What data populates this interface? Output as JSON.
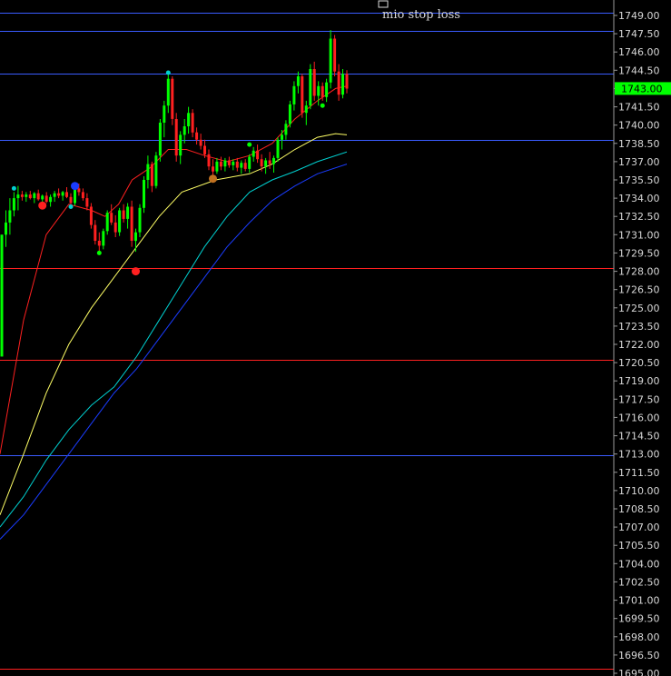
{
  "chart_data": {
    "type": "candlestick",
    "ylim": [
      1695.0,
      1750.5
    ],
    "y_ticks": [
      "1749.00",
      "1747.50",
      "1746.00",
      "1744.50",
      "1743.00",
      "1741.50",
      "1740.00",
      "1738.50",
      "1737.00",
      "1735.50",
      "1734.00",
      "1732.50",
      "1731.00",
      "1729.50",
      "1728.00",
      "1726.50",
      "1725.00",
      "1723.50",
      "1722.00",
      "1720.50",
      "1719.00",
      "1717.50",
      "1716.00",
      "1714.50",
      "1713.00",
      "1711.50",
      "1710.00",
      "1708.50",
      "1707.00",
      "1705.50",
      "1704.00",
      "1702.50",
      "1701.00",
      "1699.50",
      "1698.00",
      "1696.50",
      "1695.00"
    ],
    "last_price": "1743.00",
    "annotation": "mio stop loss",
    "colors": {
      "background": "#000000",
      "up": "#00ff00",
      "down": "#ff2020",
      "ema_fast": "#ff2020",
      "ema_mid": "#ffff66",
      "ema_slow": "#00d0d0",
      "ema_slowest": "#1a3cff",
      "level_blue": "#3a5cff",
      "level_red": "#ff2020",
      "badge": "#00ff00"
    },
    "levels": [
      {
        "value": 1749.2,
        "color": "blue"
      },
      {
        "value": 1747.7,
        "color": "blue"
      },
      {
        "value": 1744.2,
        "color": "blue"
      },
      {
        "value": 1738.8,
        "color": "blue"
      },
      {
        "value": 1728.3,
        "color": "red"
      },
      {
        "value": 1720.7,
        "color": "red"
      },
      {
        "value": 1712.9,
        "color": "blue"
      },
      {
        "value": 1695.4,
        "color": "red"
      }
    ],
    "candles": [
      [
        1721,
        1731,
        1721,
        1731
      ],
      [
        1731,
        1733,
        1730,
        1732
      ],
      [
        1732,
        1734,
        1731,
        1733
      ],
      [
        1733,
        1734.5,
        1732.5,
        1734
      ],
      [
        1734,
        1735,
        1733,
        1734.3
      ],
      [
        1734.3,
        1734.6,
        1733.8,
        1734.1
      ],
      [
        1734.1,
        1734.5,
        1733.7,
        1734.3
      ],
      [
        1734.3,
        1734.6,
        1733.9,
        1734.0
      ],
      [
        1734.0,
        1734.5,
        1733.6,
        1734.4
      ],
      [
        1734.4,
        1734.7,
        1733.8,
        1733.9
      ],
      [
        1733.9,
        1734.3,
        1733.4,
        1734.2
      ],
      [
        1734.2,
        1734.5,
        1733.6,
        1733.7
      ],
      [
        1733.7,
        1734.3,
        1733.3,
        1734.1
      ],
      [
        1734.1,
        1734.6,
        1733.7,
        1734.4
      ],
      [
        1734.4,
        1734.8,
        1734.0,
        1734.2
      ],
      [
        1734.2,
        1734.6,
        1733.8,
        1734.5
      ],
      [
        1734.5,
        1734.9,
        1734.0,
        1734.1
      ],
      [
        1734.1,
        1734.4,
        1733.3,
        1733.6
      ],
      [
        1733.6,
        1735.0,
        1733.4,
        1734.8
      ],
      [
        1734.8,
        1735.2,
        1734.2,
        1734.5
      ],
      [
        1734.5,
        1734.8,
        1733.8,
        1734.0
      ],
      [
        1734.0,
        1734.4,
        1733.0,
        1733.3
      ],
      [
        1733.3,
        1733.6,
        1731.5,
        1731.8
      ],
      [
        1731.8,
        1732.2,
        1730.2,
        1730.5
      ],
      [
        1730.5,
        1731.2,
        1729.6,
        1730.1
      ],
      [
        1730.1,
        1731.5,
        1729.8,
        1731.3
      ],
      [
        1731.3,
        1733.0,
        1731.0,
        1732.8
      ],
      [
        1732.8,
        1733.5,
        1731.8,
        1732.0
      ],
      [
        1732.0,
        1732.6,
        1730.8,
        1731.2
      ],
      [
        1731.2,
        1733.2,
        1730.9,
        1733.0
      ],
      [
        1733.0,
        1733.5,
        1732.0,
        1732.3
      ],
      [
        1732.3,
        1733.6,
        1731.5,
        1733.3
      ],
      [
        1733.3,
        1733.8,
        1730.0,
        1730.5
      ],
      [
        1730.5,
        1731.5,
        1729.6,
        1731.2
      ],
      [
        1731.2,
        1733.5,
        1730.8,
        1733.2
      ],
      [
        1733.2,
        1735.8,
        1732.8,
        1735.5
      ],
      [
        1735.5,
        1737.5,
        1734.8,
        1736.8
      ],
      [
        1736.8,
        1737.0,
        1734.5,
        1735.0
      ],
      [
        1735.0,
        1737.8,
        1734.8,
        1737.5
      ],
      [
        1737.5,
        1740.5,
        1737.0,
        1740.2
      ],
      [
        1740.2,
        1742.0,
        1739.0,
        1741.6
      ],
      [
        1741.6,
        1744.2,
        1741.0,
        1743.8
      ],
      [
        1743.8,
        1744.0,
        1740.0,
        1740.5
      ],
      [
        1740.5,
        1741.0,
        1737.0,
        1737.5
      ],
      [
        1737.5,
        1739.5,
        1736.8,
        1739.2
      ],
      [
        1739.2,
        1740.5,
        1738.5,
        1739.9
      ],
      [
        1739.9,
        1741.5,
        1739.3,
        1741.0
      ],
      [
        1741.0,
        1741.3,
        1739.0,
        1739.4
      ],
      [
        1739.4,
        1739.8,
        1738.4,
        1738.8
      ],
      [
        1738.8,
        1739.3,
        1738.0,
        1738.3
      ],
      [
        1738.3,
        1738.8,
        1737.3,
        1737.6
      ],
      [
        1737.6,
        1738.0,
        1736.3,
        1736.6
      ],
      [
        1736.6,
        1737.2,
        1735.8,
        1736.2
      ],
      [
        1736.2,
        1737.3,
        1736.0,
        1737.0
      ],
      [
        1737.0,
        1737.4,
        1736.3,
        1736.6
      ],
      [
        1736.6,
        1737.3,
        1736.2,
        1737.1
      ],
      [
        1737.1,
        1737.4,
        1736.5,
        1736.7
      ],
      [
        1736.7,
        1737.2,
        1736.3,
        1737.0
      ],
      [
        1737.0,
        1737.3,
        1736.2,
        1736.5
      ],
      [
        1736.5,
        1737.1,
        1736.0,
        1736.9
      ],
      [
        1736.9,
        1737.2,
        1736.2,
        1736.4
      ],
      [
        1736.4,
        1737.6,
        1736.1,
        1737.4
      ],
      [
        1737.4,
        1738.2,
        1737.0,
        1737.9
      ],
      [
        1737.9,
        1738.4,
        1736.9,
        1737.2
      ],
      [
        1737.2,
        1737.6,
        1736.2,
        1736.6
      ],
      [
        1736.6,
        1737.3,
        1736.0,
        1737.1
      ],
      [
        1737.1,
        1737.8,
        1736.4,
        1736.8
      ],
      [
        1736.8,
        1737.5,
        1736.1,
        1737.3
      ],
      [
        1737.3,
        1739.0,
        1737.0,
        1738.8
      ],
      [
        1738.8,
        1739.6,
        1738.0,
        1739.2
      ],
      [
        1739.2,
        1740.4,
        1738.8,
        1740.1
      ],
      [
        1740.1,
        1742.0,
        1739.8,
        1741.7
      ],
      [
        1741.7,
        1743.6,
        1741.2,
        1743.2
      ],
      [
        1743.2,
        1744.4,
        1742.6,
        1744.0
      ],
      [
        1744.0,
        1744.2,
        1740.6,
        1741.0
      ],
      [
        1741.0,
        1742.0,
        1740.0,
        1741.6
      ],
      [
        1741.6,
        1745.0,
        1741.3,
        1744.6
      ],
      [
        1744.6,
        1745.2,
        1742.0,
        1742.4
      ],
      [
        1742.4,
        1743.6,
        1741.6,
        1743.2
      ],
      [
        1743.2,
        1743.5,
        1742.0,
        1742.3
      ],
      [
        1742.3,
        1743.8,
        1741.9,
        1743.5
      ],
      [
        1743.5,
        1747.8,
        1743.0,
        1747.1
      ],
      [
        1747.1,
        1747.4,
        1744.0,
        1744.4
      ],
      [
        1744.4,
        1745.0,
        1742.0,
        1742.5
      ],
      [
        1742.5,
        1744.6,
        1742.2,
        1744.2
      ],
      [
        1744.2,
        1744.5,
        1742.6,
        1743.0
      ]
    ],
    "ema_fast": [
      [
        0,
        1713
      ],
      [
        10,
        1724
      ],
      [
        20,
        1731
      ],
      [
        30,
        1733.5
      ],
      [
        40,
        1733
      ],
      [
        46,
        1732.5
      ],
      [
        52,
        1733.5
      ],
      [
        58,
        1735.5
      ],
      [
        66,
        1736.5
      ],
      [
        74,
        1738
      ],
      [
        82,
        1738
      ],
      [
        90,
        1737.5
      ],
      [
        100,
        1737
      ],
      [
        110,
        1737.5
      ],
      [
        120,
        1738.5
      ],
      [
        130,
        1740.5
      ],
      [
        140,
        1742
      ],
      [
        148,
        1743
      ],
      [
        153,
        1743.2
      ]
    ],
    "ema_mid": [
      [
        0,
        1708
      ],
      [
        10,
        1713
      ],
      [
        20,
        1718
      ],
      [
        30,
        1722
      ],
      [
        40,
        1725
      ],
      [
        50,
        1727.5
      ],
      [
        60,
        1730
      ],
      [
        70,
        1732.5
      ],
      [
        80,
        1734.5
      ],
      [
        95,
        1735.5
      ],
      [
        110,
        1736
      ],
      [
        120,
        1736.8
      ],
      [
        130,
        1738
      ],
      [
        140,
        1739
      ],
      [
        148,
        1739.3
      ],
      [
        153,
        1739.2
      ]
    ],
    "ema_slow": [
      [
        0,
        1707
      ],
      [
        10,
        1709.5
      ],
      [
        20,
        1712.5
      ],
      [
        30,
        1715
      ],
      [
        40,
        1717
      ],
      [
        50,
        1718.5
      ],
      [
        60,
        1721
      ],
      [
        70,
        1724
      ],
      [
        80,
        1727
      ],
      [
        90,
        1730
      ],
      [
        100,
        1732.5
      ],
      [
        110,
        1734.5
      ],
      [
        120,
        1735.5
      ],
      [
        130,
        1736.2
      ],
      [
        140,
        1737
      ],
      [
        153,
        1737.8
      ]
    ],
    "ema_slowest": [
      [
        0,
        1706
      ],
      [
        10,
        1708
      ],
      [
        20,
        1710.5
      ],
      [
        30,
        1713
      ],
      [
        40,
        1715.5
      ],
      [
        50,
        1718
      ],
      [
        60,
        1720
      ],
      [
        70,
        1722.5
      ],
      [
        80,
        1725
      ],
      [
        90,
        1727.5
      ],
      [
        100,
        1730
      ],
      [
        110,
        1732
      ],
      [
        120,
        1733.8
      ],
      [
        130,
        1735
      ],
      [
        140,
        1736
      ],
      [
        153,
        1736.8
      ]
    ],
    "markers": [
      {
        "i": 3,
        "v": 1734.8,
        "color": "#00d0d0",
        "type": "small"
      },
      {
        "i": 10,
        "v": 1733.4,
        "color": "#ff2020",
        "type": "big"
      },
      {
        "i": 17,
        "v": 1733.3,
        "color": "#00d0d0",
        "type": "small"
      },
      {
        "i": 18,
        "v": 1735.0,
        "color": "#1a3cff",
        "type": "big"
      },
      {
        "i": 24,
        "v": 1729.5,
        "color": "#00ff00",
        "type": "small"
      },
      {
        "i": 33,
        "v": 1728.0,
        "color": "#ff2020",
        "type": "big"
      },
      {
        "i": 41,
        "v": 1744.3,
        "color": "#00d0d0",
        "type": "small"
      },
      {
        "i": 52,
        "v": 1735.6,
        "color": "#c07020",
        "type": "big"
      },
      {
        "i": 61,
        "v": 1738.4,
        "color": "#00ff00",
        "type": "small"
      },
      {
        "i": 79,
        "v": 1741.6,
        "color": "#00ff00",
        "type": "small"
      }
    ]
  }
}
